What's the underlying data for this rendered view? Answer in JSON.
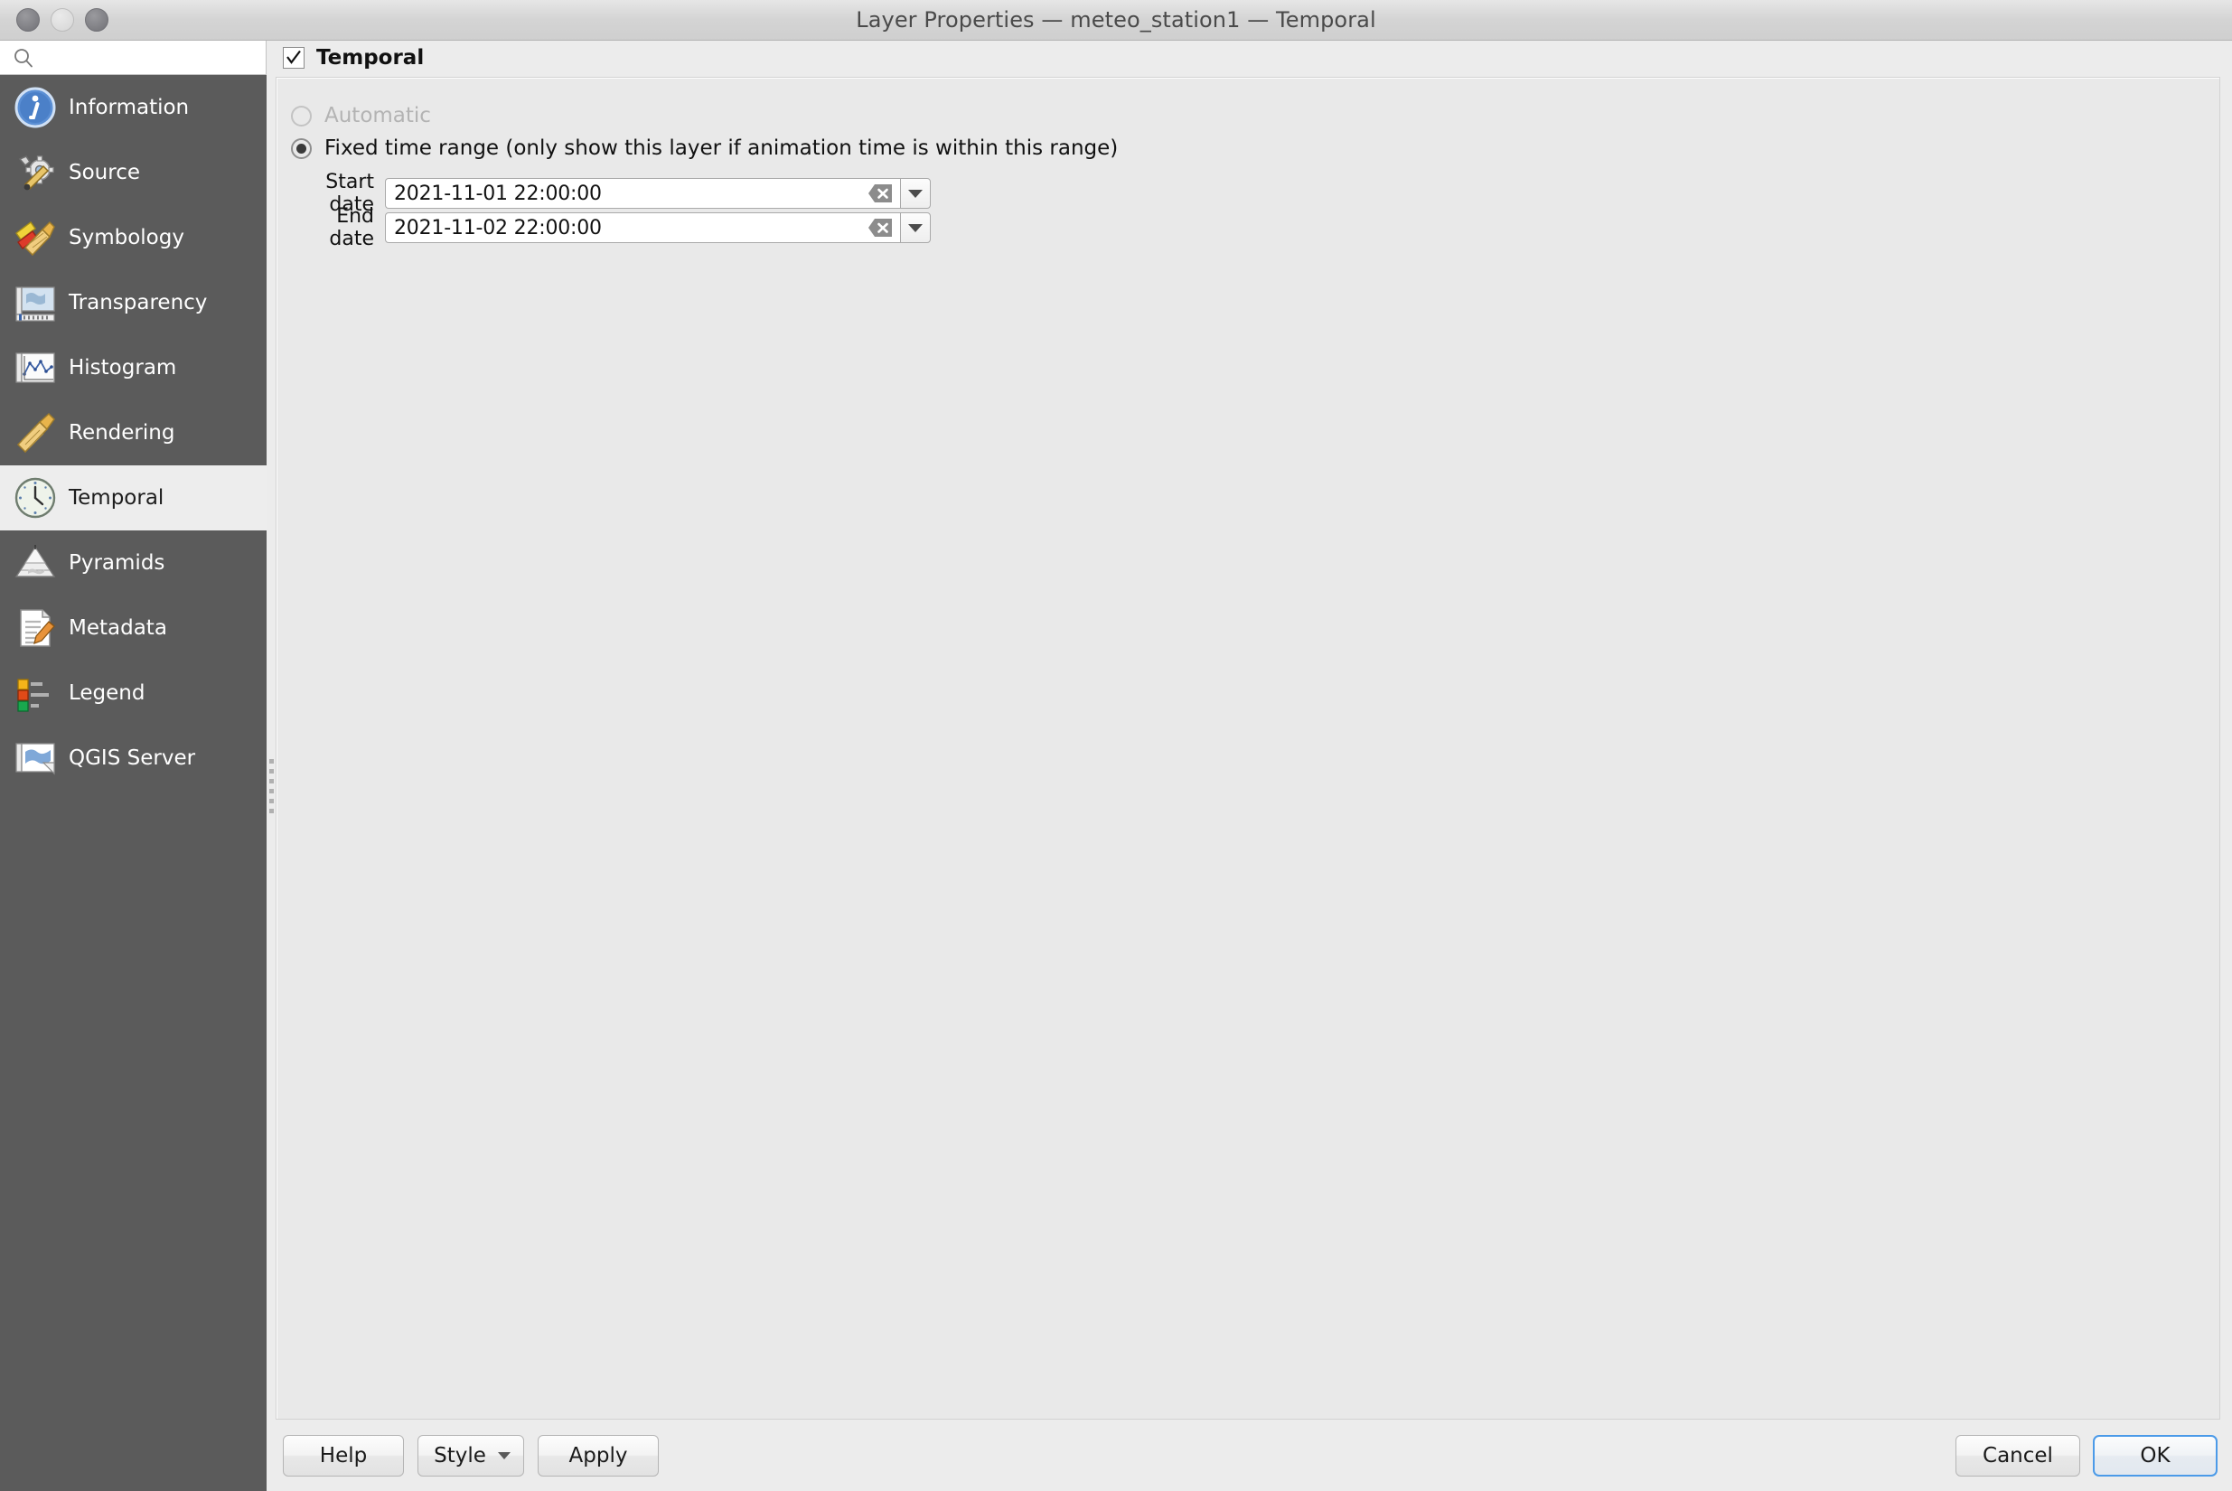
{
  "window": {
    "title": "Layer Properties — meteo_station1 — Temporal",
    "controls": {
      "close": "close-button",
      "minimize": "minimize-button",
      "maximize": "maximize-button"
    }
  },
  "sidebar": {
    "search": {
      "value": "",
      "placeholder": ""
    },
    "items": [
      {
        "label": "Information",
        "icon": "information-icon",
        "selected": false
      },
      {
        "label": "Source",
        "icon": "source-icon",
        "selected": false
      },
      {
        "label": "Symbology",
        "icon": "symbology-icon",
        "selected": false
      },
      {
        "label": "Transparency",
        "icon": "transparency-icon",
        "selected": false
      },
      {
        "label": "Histogram",
        "icon": "histogram-icon",
        "selected": false
      },
      {
        "label": "Rendering",
        "icon": "rendering-icon",
        "selected": false
      },
      {
        "label": "Temporal",
        "icon": "temporal-clock-icon",
        "selected": true
      },
      {
        "label": "Pyramids",
        "icon": "pyramids-icon",
        "selected": false
      },
      {
        "label": "Metadata",
        "icon": "metadata-icon",
        "selected": false
      },
      {
        "label": "Legend",
        "icon": "legend-icon",
        "selected": false
      },
      {
        "label": "QGIS Server",
        "icon": "qgis-server-icon",
        "selected": false
      }
    ]
  },
  "panel": {
    "title": "Temporal",
    "enabled_checkbox": {
      "checked": true,
      "label": "Temporal"
    },
    "mode_options": [
      {
        "label": "Automatic",
        "selected": false,
        "disabled": true
      },
      {
        "label": "Fixed time range (only show this layer if animation time is within this range)",
        "selected": true,
        "disabled": false
      }
    ],
    "fields": [
      {
        "label": "Start date",
        "value": "2021-11-01 22:00:00",
        "clear_icon": "clear-icon",
        "dropdown_icon": "chevron-down-icon"
      },
      {
        "label": "End date",
        "value": "2021-11-02 22:00:00",
        "clear_icon": "clear-icon",
        "dropdown_icon": "chevron-down-icon"
      }
    ]
  },
  "buttons": {
    "help": "Help",
    "style": "Style",
    "apply": "Apply",
    "cancel": "Cancel",
    "ok": "OK"
  },
  "colors": {
    "sidebar_bg": "#5b5b5b",
    "selected_bg": "#ededed",
    "panel_bg": "#ececec",
    "group_bg": "#e9e9e9",
    "focus_ring": "#4b9ae8"
  }
}
